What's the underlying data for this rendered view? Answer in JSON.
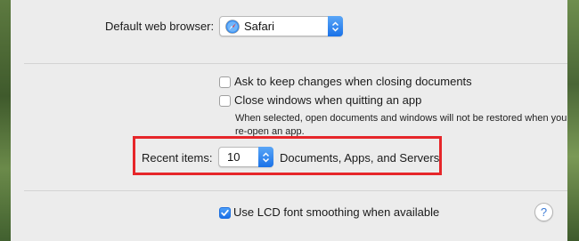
{
  "default_browser": {
    "label": "Default web browser:",
    "value": "Safari",
    "icon": "safari-compass-icon"
  },
  "options": {
    "ask_keep_changes": {
      "label": "Ask to keep changes when closing documents",
      "checked": false
    },
    "close_windows": {
      "label": "Close windows when quitting an app",
      "checked": false
    },
    "note": "When selected, open documents and windows will not be restored when you re-open an app."
  },
  "recent_items": {
    "label": "Recent items:",
    "value": "10",
    "suffix": "Documents, Apps, and Servers",
    "highlight_color": "#e6262a"
  },
  "lcd_smoothing": {
    "label": "Use LCD font smoothing when available",
    "checked": true
  },
  "help_button": {
    "label": "?"
  },
  "colors": {
    "accent": "#1a72e8",
    "panel": "#ececec"
  }
}
